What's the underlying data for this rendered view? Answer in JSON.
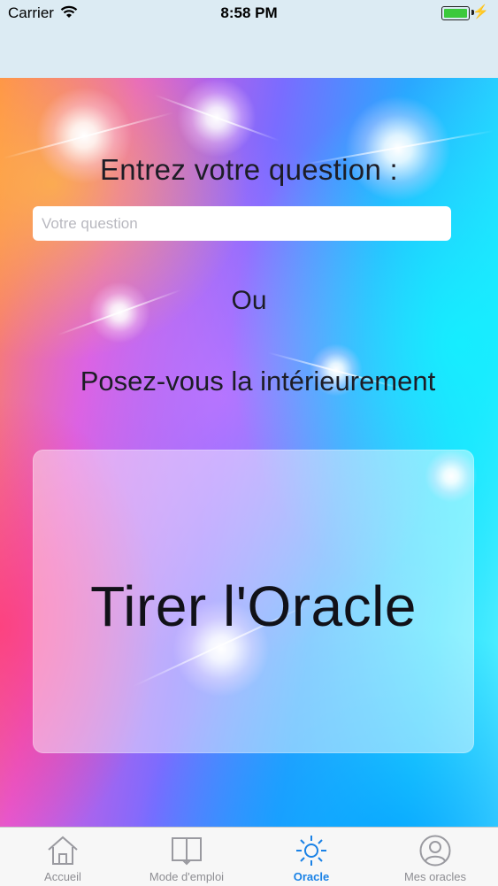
{
  "status_bar": {
    "carrier": "Carrier",
    "time": "8:58 PM"
  },
  "main": {
    "prompt": "Entrez votre question :",
    "question_placeholder": "Votre question",
    "question_value": "",
    "or_label": "Ou",
    "inner_label": "Posez-vous la intérieurement",
    "draw_button": "Tirer l'Oracle"
  },
  "tabs": [
    {
      "label": "Accueil",
      "icon": "home-icon",
      "active": false
    },
    {
      "label": "Mode d'emploi",
      "icon": "book-icon",
      "active": false
    },
    {
      "label": "Oracle",
      "icon": "sun-icon",
      "active": true
    },
    {
      "label": "Mes oracles",
      "icon": "user-circle-icon",
      "active": false
    }
  ],
  "colors": {
    "accent": "#1a82e6",
    "inactive": "#8e8e93"
  }
}
